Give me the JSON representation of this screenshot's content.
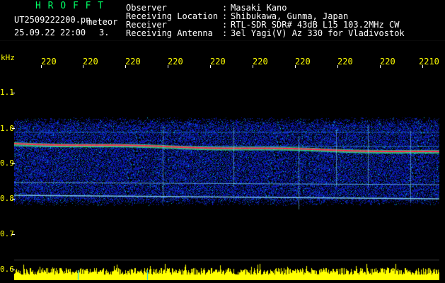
{
  "header": {
    "app_name": "H R O F F T",
    "filename": "UT2509222200.pn",
    "meteor_label": "meteor",
    "date_time": "25.09.22 22:00",
    "count": "3.",
    "fields": [
      {
        "label": "Observer",
        "sep": ":",
        "value": "Masaki Kano"
      },
      {
        "label": "Receiving Location",
        "sep": ":",
        "value": "Shibukawa, Gunma, Japan"
      },
      {
        "label": "Receiver",
        "sep": ":",
        "value": "RTL-SDR SDR# 43dB L15 103.2MHz CW"
      },
      {
        "label": "Receiving Antenna",
        "sep": ":",
        "value": "3el Yagi(V) Az 330 for Vladivostok"
      }
    ]
  },
  "axes": {
    "unit": "kHz",
    "x_ticks": [
      "220",
      "220",
      "220",
      "220",
      "220",
      "220",
      "220",
      "220",
      "220",
      "2210"
    ],
    "y_ticks": [
      "1.1",
      "1.0",
      "0.9",
      "0.8",
      "0.7",
      "0.6"
    ]
  },
  "colors": {
    "background": "#000000",
    "label_yellow": "#ffff00",
    "title_green": "#00ff66",
    "text_white": "#ffffff",
    "noise_blue": "#1030c0",
    "signal_red": "#ff2050",
    "meteor_green": "#40ff80",
    "amplitude_yellow": "#ffff00"
  }
}
